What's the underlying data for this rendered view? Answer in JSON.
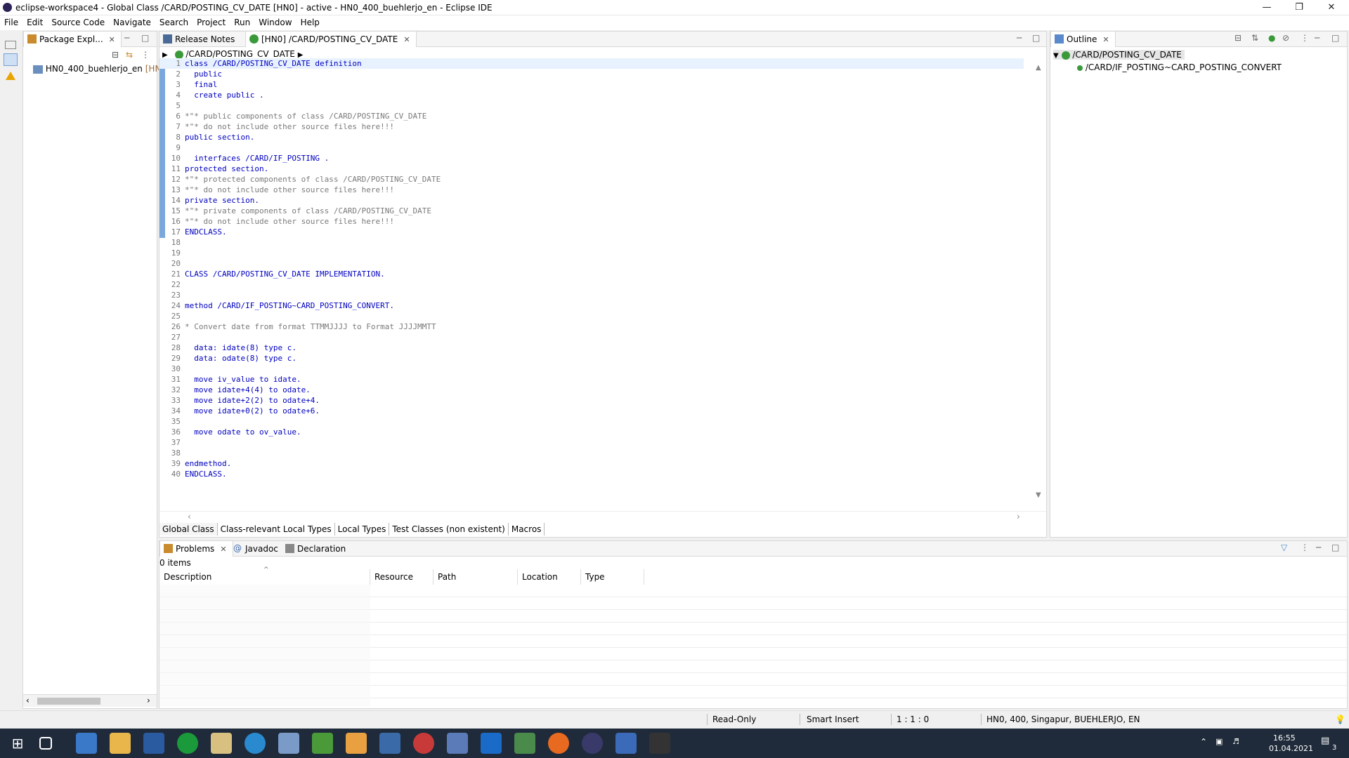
{
  "window": {
    "title": "eclipse-workspace4 - Global Class /CARD/POSTING_CV_DATE [HN0]  - active - HN0_400_buehlerjo_en - Eclipse IDE"
  },
  "menu": [
    "File",
    "Edit",
    "Source Code",
    "Navigate",
    "Search",
    "Project",
    "Run",
    "Window",
    "Help"
  ],
  "package_explorer": {
    "tab": "Package Expl...",
    "project": "HN0_400_buehlerjo_en",
    "project_suffix": "[HN"
  },
  "editor": {
    "tabs": [
      "Release Notes",
      "[HN0] /CARD/POSTING_CV_DATE"
    ],
    "breadcrumb": "/CARD/POSTING_CV_DATE",
    "lines": [
      {
        "n": "1",
        "t": "class /CARD/POSTING_CV_DATE definition",
        "k": "kw"
      },
      {
        "n": "2",
        "t": "  public",
        "k": "kw"
      },
      {
        "n": "3",
        "t": "  final",
        "k": "kw"
      },
      {
        "n": "4",
        "t": "  create public .",
        "k": "kw"
      },
      {
        "n": "5",
        "t": "",
        "k": ""
      },
      {
        "n": "6",
        "t": "*\"* public components of class /CARD/POSTING_CV_DATE",
        "k": "cm"
      },
      {
        "n": "7",
        "t": "*\"* do not include other source files here!!!",
        "k": "cm"
      },
      {
        "n": "8",
        "t": "public section.",
        "k": "kw"
      },
      {
        "n": "9",
        "t": "",
        "k": ""
      },
      {
        "n": "10",
        "t": "  interfaces /CARD/IF_POSTING .",
        "k": "kw"
      },
      {
        "n": "11",
        "t": "protected section.",
        "k": "kw"
      },
      {
        "n": "12",
        "t": "*\"* protected components of class /CARD/POSTING_CV_DATE",
        "k": "cm"
      },
      {
        "n": "13",
        "t": "*\"* do not include other source files here!!!",
        "k": "cm"
      },
      {
        "n": "14",
        "t": "private section.",
        "k": "kw"
      },
      {
        "n": "15",
        "t": "*\"* private components of class /CARD/POSTING_CV_DATE",
        "k": "cm"
      },
      {
        "n": "16",
        "t": "*\"* do not include other source files here!!!",
        "k": "cm"
      },
      {
        "n": "17",
        "t": "ENDCLASS.",
        "k": "kw"
      },
      {
        "n": "18",
        "t": "",
        "k": ""
      },
      {
        "n": "19",
        "t": "",
        "k": ""
      },
      {
        "n": "20",
        "t": "",
        "k": ""
      },
      {
        "n": "21",
        "t": "CLASS /CARD/POSTING_CV_DATE IMPLEMENTATION.",
        "k": "kw"
      },
      {
        "n": "22",
        "t": "",
        "k": ""
      },
      {
        "n": "23",
        "t": "",
        "k": ""
      },
      {
        "n": "24",
        "t": "method /CARD/IF_POSTING~CARD_POSTING_CONVERT.",
        "k": "kw"
      },
      {
        "n": "25",
        "t": "",
        "k": ""
      },
      {
        "n": "26",
        "t": "* Convert date from format TTMMJJJJ to Format JJJJMMTT",
        "k": "cm"
      },
      {
        "n": "27",
        "t": "",
        "k": ""
      },
      {
        "n": "28",
        "t": "  data: idate(8) type c.",
        "k": "kw"
      },
      {
        "n": "29",
        "t": "  data: odate(8) type c.",
        "k": "kw"
      },
      {
        "n": "30",
        "t": "",
        "k": ""
      },
      {
        "n": "31",
        "t": "  move iv_value to idate.",
        "k": "kw"
      },
      {
        "n": "32",
        "t": "  move idate+4(4) to odate.",
        "k": "kw"
      },
      {
        "n": "33",
        "t": "  move idate+2(2) to odate+4.",
        "k": "kw"
      },
      {
        "n": "34",
        "t": "  move idate+0(2) to odate+6.",
        "k": "kw"
      },
      {
        "n": "35",
        "t": "",
        "k": ""
      },
      {
        "n": "36",
        "t": "  move odate to ov_value.",
        "k": "kw"
      },
      {
        "n": "37",
        "t": "",
        "k": ""
      },
      {
        "n": "38",
        "t": "",
        "k": ""
      },
      {
        "n": "39",
        "t": "endmethod.",
        "k": "kw"
      },
      {
        "n": "40",
        "t": "ENDCLASS.",
        "k": "kw"
      }
    ],
    "bottom_tabs": [
      "Global Class",
      "Class-relevant Local Types",
      "Local Types",
      "Test Classes (non existent)",
      "Macros"
    ]
  },
  "outline": {
    "tab": "Outline",
    "root": "/CARD/POSTING_CV_DATE",
    "child": "/CARD/IF_POSTING~CARD_POSTING_CONVERT"
  },
  "problems": {
    "tabs": [
      "Problems",
      "Javadoc",
      "Declaration"
    ],
    "count": "0 items",
    "columns": [
      "Description",
      "Resource",
      "Path",
      "Location",
      "Type"
    ]
  },
  "status": {
    "mode": "Read-Only",
    "insert": "Smart Insert",
    "position": "1 : 1 : 0",
    "system": "HN0, 400, Singapur, BUEHLERJO, EN"
  },
  "taskbar": {
    "time": "16:55",
    "date": "01.04.2021",
    "notifications": "3"
  }
}
